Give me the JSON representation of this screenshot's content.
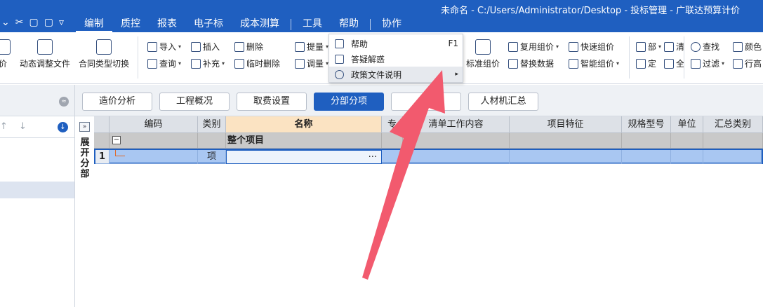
{
  "window": {
    "title": "未命名 - C:/Users/Administrator/Desktop - 投标管理 - 广联达预算计价"
  },
  "quick_access": [
    "⌄",
    "✂",
    "▢",
    "▢",
    "▿"
  ],
  "menu": {
    "items": [
      "编制",
      "质控",
      "报表",
      "电子标",
      "成本测算",
      "工具",
      "帮助",
      "协作"
    ],
    "active": "编制"
  },
  "ribbon": {
    "left_partial": "价",
    "dynamic_adjust": "动态调整文件",
    "contract_switch": "合同类型切换",
    "import": "导入",
    "query": "查询",
    "insert": "插入",
    "supplement": "补充",
    "delete": "删除",
    "temp_delete": "临时删除",
    "extract": "提量",
    "adjust": "调量",
    "standard_price": "标准组价",
    "reuse_price": "复用组价",
    "replace_data": "替换数据",
    "quick_price": "快速组价",
    "smart_price": "智能组价",
    "part_label": "部",
    "clear_label": "清",
    "fix_label": "定",
    "all_label": "全",
    "find": "查找",
    "filter": "过滤",
    "color": "颜色",
    "row_height": "行高"
  },
  "dropdown": {
    "items": [
      {
        "label": "帮助",
        "shortcut": "F1"
      },
      {
        "label": "答疑解惑",
        "shortcut": ""
      },
      {
        "label": "政策文件说明",
        "shortcut": "▸"
      }
    ]
  },
  "left_panel": {
    "collapse_icon": "≈",
    "up_down": "↑ ↓",
    "download_icon": "↓"
  },
  "expand_strip": {
    "button": "»",
    "label": "展开分部"
  },
  "tabs": [
    {
      "label": "造价分析"
    },
    {
      "label": "工程概况"
    },
    {
      "label": "取费设置"
    },
    {
      "label": "分部分项",
      "active": true
    },
    {
      "label": ""
    },
    {
      "label": "人材机汇总"
    }
  ],
  "grid": {
    "columns": [
      "编码",
      "类别",
      "名称",
      "专",
      "清单工作内容",
      "项目特征",
      "规格型号",
      "单位",
      "汇总类别"
    ],
    "selected_column": "名称",
    "project_row": {
      "name": "整个项目"
    },
    "rows": [
      {
        "index": "1",
        "type": "项",
        "name": "",
        "ellipsis": "···"
      }
    ]
  },
  "colors": {
    "title_blue": "#1f5fc0",
    "selection_blue": "#a9c7f2",
    "arrow_red": "#f25a6e"
  }
}
